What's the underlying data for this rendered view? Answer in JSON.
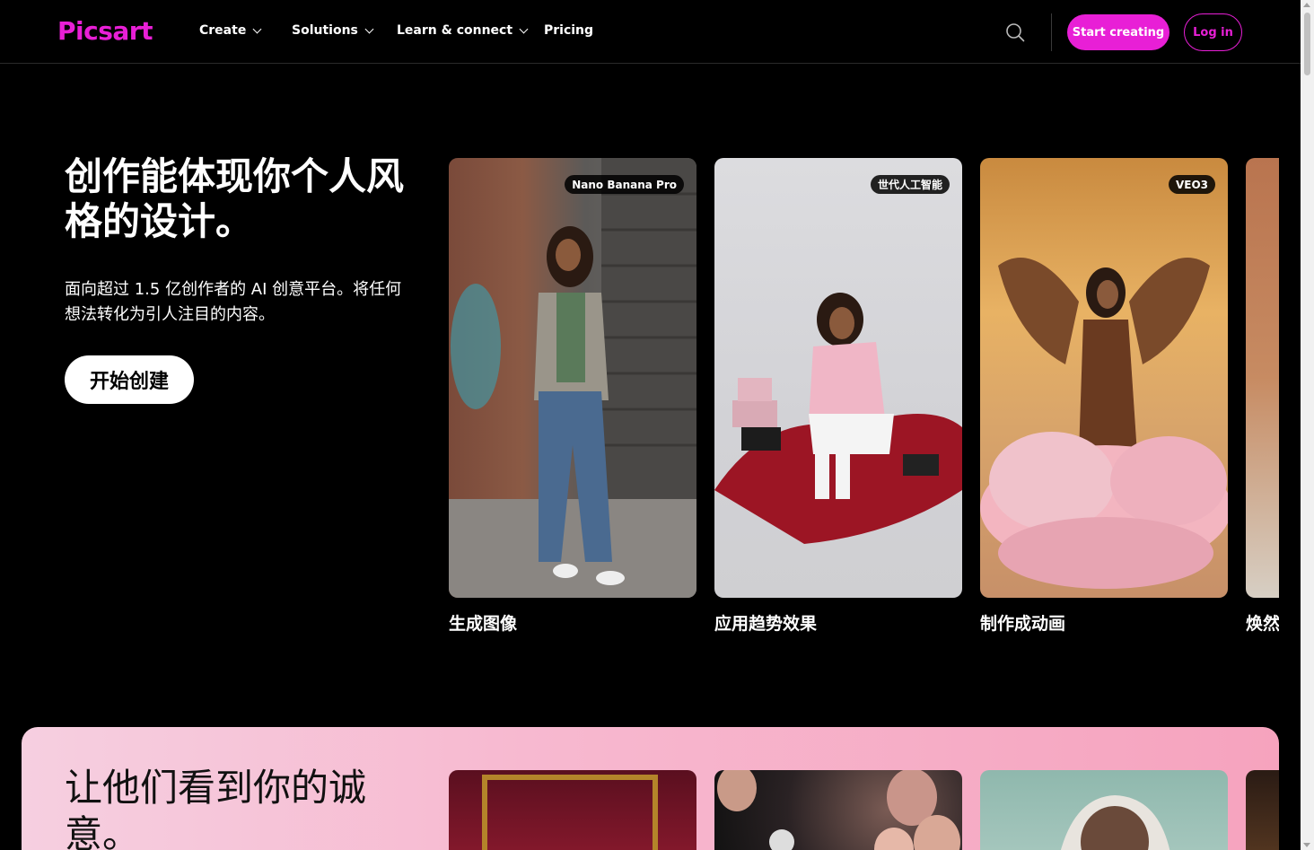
{
  "nav": {
    "logo": "Picsart",
    "items": [
      {
        "label": "Create",
        "has_dropdown": true
      },
      {
        "label": "Solutions",
        "has_dropdown": true
      },
      {
        "label": "Learn & connect",
        "has_dropdown": true
      },
      {
        "label": "Pricing",
        "has_dropdown": false
      }
    ],
    "search_icon": "search-icon",
    "start_creating": "Start creating",
    "login": "Log in"
  },
  "hero": {
    "title": "创作能体现你个人风格的设计。",
    "subtitle": "面向超过 1.5 亿创作者的 AI 创意平台。将任何想法转化为引人注目的内容。",
    "cta": "开始创建",
    "cards": [
      {
        "badge": "Nano Banana Pro",
        "label": "生成图像"
      },
      {
        "badge": "世代人工智能",
        "label": "应用趋势效果"
      },
      {
        "badge": "VEO3",
        "label": "制作成动画"
      },
      {
        "badge": "",
        "label": "焕然"
      }
    ]
  },
  "section2": {
    "title": "让他们看到你的诚意。"
  },
  "colors": {
    "brand": "#e81fd6",
    "background": "#000000"
  }
}
